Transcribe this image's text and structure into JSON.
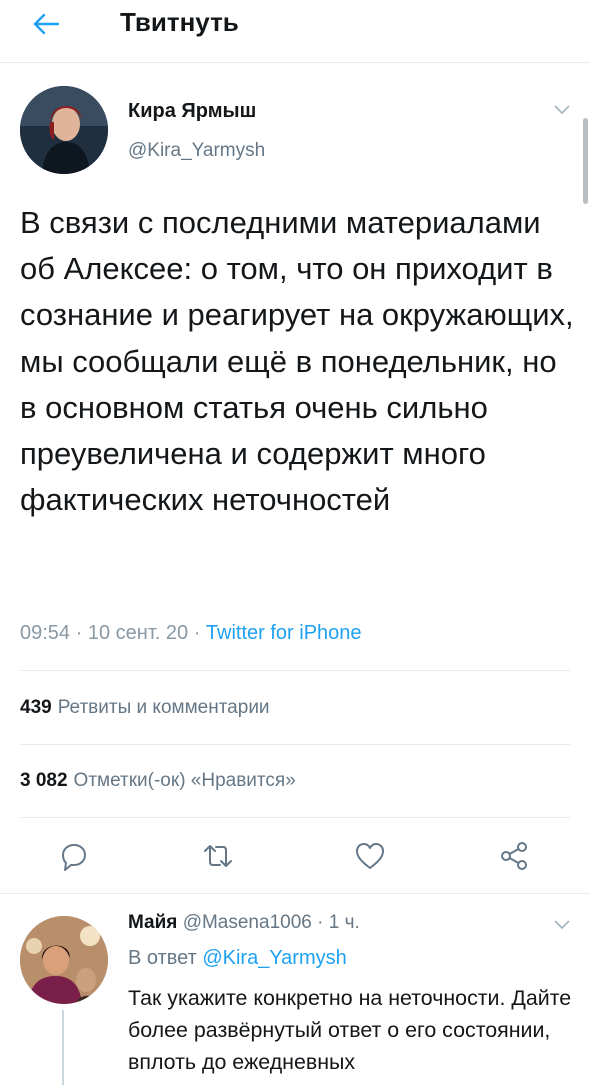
{
  "header": {
    "title": "Твитнуть",
    "back_icon": "arrow-left-icon"
  },
  "tweet": {
    "author_name": "Кира Ярмыш",
    "author_handle": "@Kira_Yarmysh",
    "text": "В связи с последними материалами об Алексее: о том, что он приходит в сознание и реагирует на окружающих, мы сообщали ещё в понедельник, но в основном статья очень сильно преувеличена и содержит много фактических неточностей",
    "time": "09:54",
    "date": "10 сент. 20",
    "source": "Twitter for iPhone",
    "retweets_count": "439",
    "retweets_label": "Ретвиты и комментарии",
    "likes_count": "3 082",
    "likes_label": "Отметки(-ок) «Нравится»"
  },
  "actions": {
    "reply_icon": "reply-icon",
    "retweet_icon": "retweet-icon",
    "like_icon": "heart-icon",
    "share_icon": "share-icon"
  },
  "reply": {
    "author_name": "Майя",
    "author_handle": "@Masena1006",
    "time_ago": "1 ч.",
    "in_reply_prefix": "В ответ",
    "in_reply_handle": "@Kira_Yarmysh",
    "text": "Так укажите конкретно на неточности. Дайте более развёрнутый ответ о его состоянии, вплоть до ежедневных"
  },
  "colors": {
    "accent": "#1da1f2",
    "text_primary": "#14171a",
    "text_secondary": "#657786",
    "divider": "#e6ecf0"
  }
}
